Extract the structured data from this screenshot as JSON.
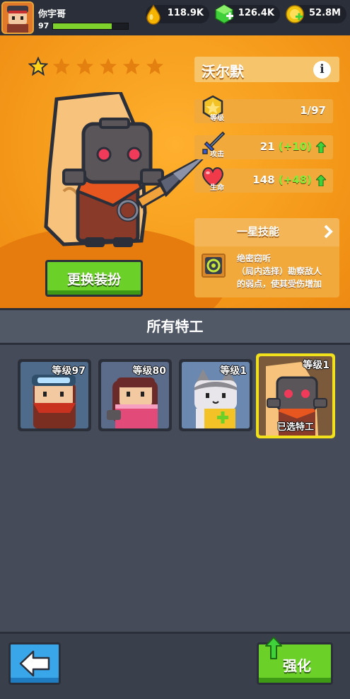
{
  "player": {
    "name": "你宇哥",
    "level": "97",
    "xp_fraction": 0.78
  },
  "currencies": [
    {
      "icon": "gold-drop-icon",
      "amount": "118.9K",
      "color": "#f4b400"
    },
    {
      "icon": "green-gem-icon",
      "amount": "126.4K",
      "color": "#3fcf3a"
    },
    {
      "icon": "gold-coin-icon",
      "amount": "52.8M",
      "color": "#f1c40f"
    }
  ],
  "hero": {
    "name": "沃尔默",
    "stars_filled": 1,
    "stars_total": 6,
    "skin_button": "更换装扮",
    "stats": {
      "level": {
        "label": "等级",
        "value": "1/97"
      },
      "attack": {
        "label": "攻击",
        "value": "21",
        "bonus": "(+10)"
      },
      "health": {
        "label": "生命",
        "value": "148",
        "bonus": "(+48)"
      }
    },
    "skill": {
      "title": "一星技能",
      "lines": [
        "绝密窃听",
        "（局内选择）勘察敌人",
        "的弱点，使其受伤增加"
      ]
    }
  },
  "agents": {
    "title": "所有特工",
    "cards": [
      {
        "level": "等级97",
        "selected": false,
        "tag": ""
      },
      {
        "level": "等级80",
        "selected": false,
        "tag": ""
      },
      {
        "level": "等级1",
        "selected": false,
        "tag": ""
      },
      {
        "level": "等级1",
        "selected": true,
        "tag": "已选特工"
      }
    ]
  },
  "bottom": {
    "upgrade_label": "强化"
  }
}
